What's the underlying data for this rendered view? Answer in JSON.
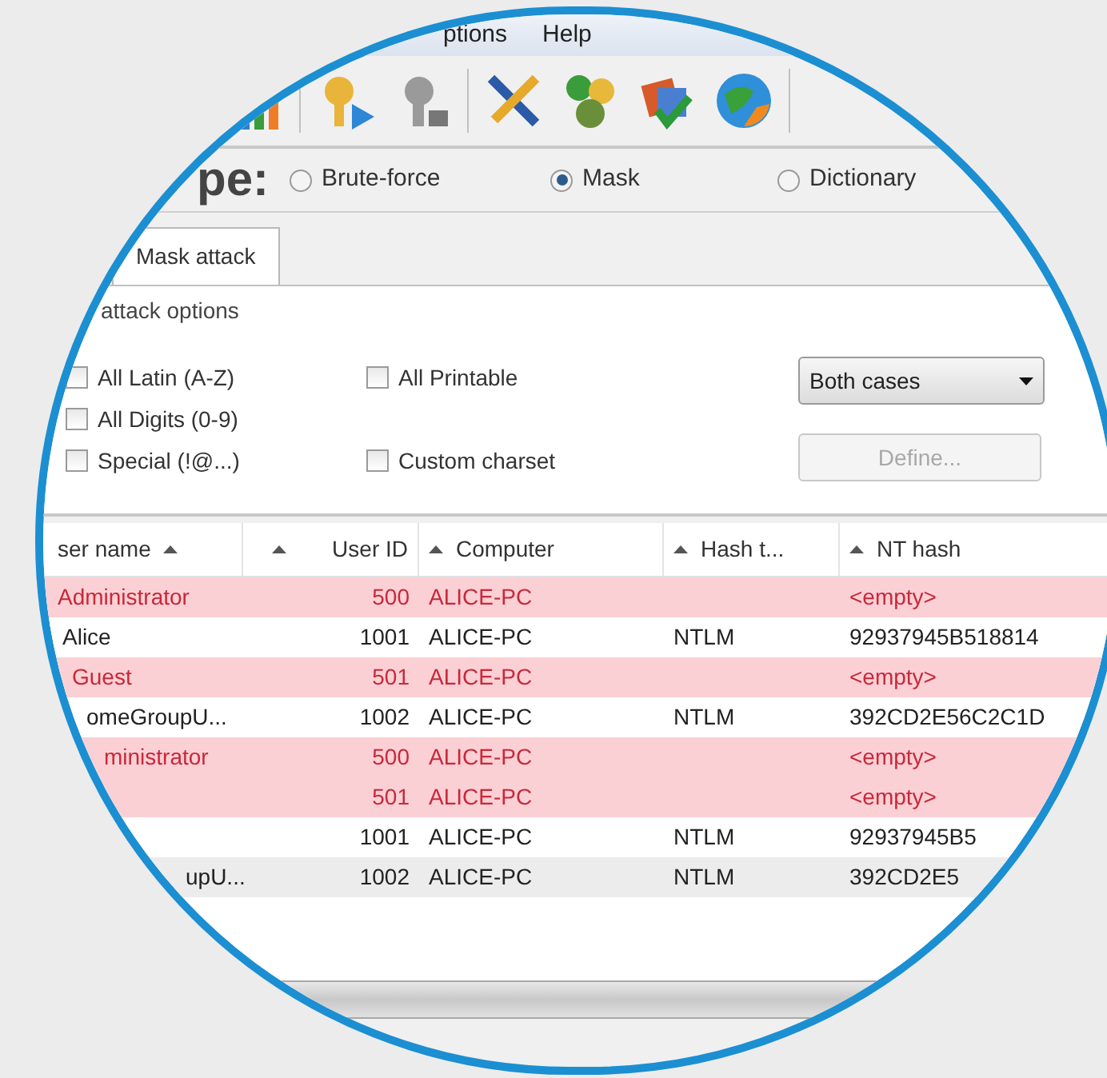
{
  "menu": [
    "ptions",
    "Help"
  ],
  "type_label": "pe:",
  "attack_types": [
    {
      "label": "Brute-force",
      "selected": false
    },
    {
      "label": "Mask",
      "selected": true
    },
    {
      "label": "Dictionary",
      "selected": false
    }
  ],
  "tabs": [
    {
      "label": "Mask attack",
      "selected": true
    }
  ],
  "group_title": "attack options",
  "charsets": [
    {
      "label": "All Latin (A-Z)",
      "checked": false
    },
    {
      "label": "All Digits (0-9)",
      "checked": false
    },
    {
      "label": "Special (!@...)",
      "checked": false
    },
    {
      "label": "All Printable",
      "checked": false
    },
    {
      "label": "Custom charset",
      "checked": false
    }
  ],
  "case_select": {
    "value": "Both cases"
  },
  "define_button": {
    "label": "Define...",
    "disabled": true
  },
  "table": {
    "columns": [
      "ser name",
      "User ID",
      "Computer",
      "Hash t...",
      "NT hash"
    ],
    "rows": [
      {
        "user": "Administrator",
        "id": "500",
        "computer": "ALICE-PC",
        "nt_hash": "<empty>",
        "flagged": true,
        "selected": false
      },
      {
        "user": "Alice",
        "id": "1001",
        "computer": "ALICE-PC",
        "hash_type": "NTLM",
        "nt_hash": "92937945B518814",
        "flagged": false,
        "selected": false
      },
      {
        "user": "Guest",
        "id": "501",
        "computer": "ALICE-PC",
        "nt_hash": "<empty>",
        "flagged": true,
        "selected": false
      },
      {
        "user": "omeGroupU...",
        "id": "1002",
        "computer": "ALICE-PC",
        "hash_type": "NTLM",
        "nt_hash": "392CD2E56C2C1D",
        "flagged": false,
        "selected": false
      },
      {
        "user": "ministrator",
        "id": "500",
        "computer": "ALICE-PC",
        "nt_hash": "<empty>",
        "flagged": true,
        "selected": false
      },
      {
        "id": "501",
        "computer": "ALICE-PC",
        "nt_hash": "<empty>",
        "flagged": true,
        "selected": false
      },
      {
        "id": "1001",
        "computer": "ALICE-PC",
        "hash_type": "NTLM",
        "nt_hash": "92937945B5",
        "flagged": false,
        "selected": false
      },
      {
        "user": "upU...",
        "id": "1002",
        "computer": "ALICE-PC",
        "hash_type": "NTLM",
        "nt_hash": "392CD2E5",
        "flagged": false,
        "selected": true
      }
    ]
  }
}
